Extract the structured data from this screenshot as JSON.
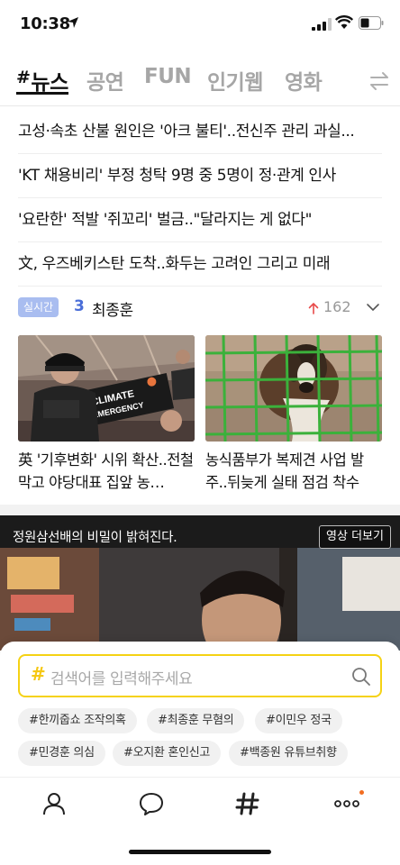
{
  "status_bar": {
    "time": "10:38"
  },
  "tabs": [
    {
      "label": "뉴스",
      "active": true
    },
    {
      "label": "공연",
      "active": false
    },
    {
      "label": "FUN",
      "active": false
    },
    {
      "label": "인기웹",
      "active": false
    },
    {
      "label": "영화",
      "active": false
    }
  ],
  "tab_hash": "#",
  "headlines": [
    "고성·속초 산불 원인은 '아크 불티'..전신주 관리 과실...",
    "'KT 채용비리' 부정 청탁 9명 중 5명이 정·관계 인사",
    "'요란한' 적발 '쥐꼬리' 벌금..\"달라지는 게 없다\"",
    "文, 우즈베키스탄 도착..화두는 고려인 그리고 미래"
  ],
  "realtime": {
    "badge": "실시간",
    "rank": "3",
    "name": "최종훈",
    "count": "162",
    "arrow_color": "#e84a4a"
  },
  "cards": [
    {
      "caption": "英 '기후변화' 시위 확산..전철 막고 야당대표 집앞 농…",
      "banner_text": "CLIMATE EMERGENCY"
    },
    {
      "caption": "농식품부가 복제견 사업 발주..뒤늦게 실태 점검 착수"
    }
  ],
  "video": {
    "title": "정원삼선배의 비밀이 밝혀진다.",
    "more_label": "영상 더보기"
  },
  "search": {
    "hash": "#",
    "placeholder": "검색어를 입력해주세요",
    "accent": "#f5d214"
  },
  "tags": [
    "#한끼줍쇼 조작의혹",
    "#최종훈 무혐의",
    "#이민우 정국",
    "#민경훈 의심",
    "#오지환 혼인신고",
    "#백종원 유튜브취향"
  ],
  "bottom_nav": [
    {
      "icon": "person-icon"
    },
    {
      "icon": "chat-bubble-icon"
    },
    {
      "icon": "hash-icon"
    },
    {
      "icon": "more-dots-icon"
    }
  ]
}
